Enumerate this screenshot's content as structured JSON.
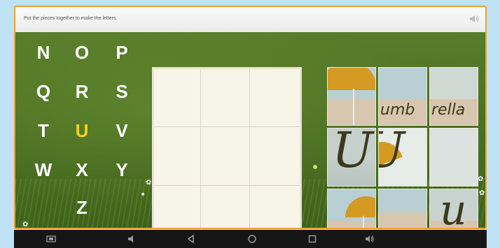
{
  "header": {
    "instruction": "Put the pieces together to make the letters.",
    "speaker_icon": "speaker-icon"
  },
  "letters": [
    {
      "char": "N",
      "selected": false
    },
    {
      "char": "O",
      "selected": false
    },
    {
      "char": "P",
      "selected": false
    },
    {
      "char": "Q",
      "selected": false
    },
    {
      "char": "R",
      "selected": false
    },
    {
      "char": "S",
      "selected": false
    },
    {
      "char": "T",
      "selected": false
    },
    {
      "char": "U",
      "selected": true
    },
    {
      "char": "V",
      "selected": false
    },
    {
      "char": "W",
      "selected": false
    },
    {
      "char": "X",
      "selected": false
    },
    {
      "char": "Y",
      "selected": false
    },
    {
      "char": "Z",
      "selected": false
    }
  ],
  "puzzle": {
    "board_cells": 9,
    "pieces": [
      {
        "id": "piece-1",
        "letter_text": ""
      },
      {
        "id": "piece-2",
        "letter_text": ""
      },
      {
        "id": "piece-3",
        "letter_text": ""
      },
      {
        "id": "piece-4",
        "letter_text": "U"
      },
      {
        "id": "piece-5",
        "letter_text": ""
      },
      {
        "id": "piece-6",
        "letter_text": ""
      },
      {
        "id": "piece-7",
        "letter_text": ""
      },
      {
        "id": "piece-8",
        "letter_text": ""
      },
      {
        "id": "piece-9",
        "letter_text": "u"
      }
    ],
    "word_fragment_left": "umb",
    "word_fragment_right": "rella"
  },
  "colors": {
    "accent_border": "#f0a030",
    "selected_letter": "#f2d21c",
    "letter": "#ffffff"
  },
  "system_nav": [
    "screenshot-icon",
    "volume-down-icon",
    "back-icon",
    "home-icon",
    "recents-icon",
    "volume-up-icon"
  ]
}
